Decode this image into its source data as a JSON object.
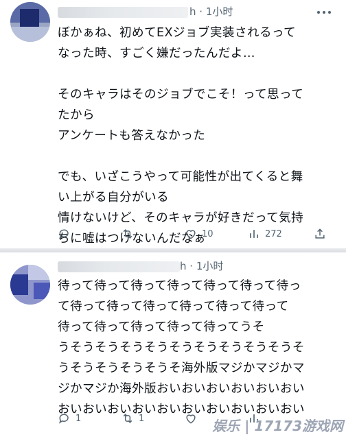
{
  "tweets": [
    {
      "time": "1小时",
      "text": "ぼかぁね、初めてEXジョブ実装されるって\nなった時、すごく嫌だったんだよ…\n\nそのキャラはそのジョブでこそ！って思って\nたから\nアンケートも答えなかった\n\nでも、いざこうやって可能性が出てくると舞\nい上がる自分がいる\n情けないけど、そのキャラが好きだって気持\nちに嘘はつけないんだなぁ",
      "actions": {
        "reply_count": "",
        "retweet_count": "",
        "like_count": "10",
        "views_count": "272"
      }
    },
    {
      "time": "1小时",
      "text": "待って待って待って待って待って待って待っ\nて待って待って待って待って待って待って\n待って待って待って待って待ってうそ\nうそうそうそうそうそうそうそうそうそうそ\nうそうそうそうそうそ海外版マジかマジかマ\nジかマジか海外版おいおいおいおいおいおい\nおいおいおいおいおいおいおいおいおいおい",
      "actions": {
        "reply_count": "1",
        "retweet_count": "1",
        "like_count": "",
        "views_count": ""
      }
    }
  ],
  "watermark": "娱乐 | 17173游戏网",
  "colors": {
    "text": "#0f1419",
    "muted": "#536471",
    "divider": "#e1e4e8"
  }
}
